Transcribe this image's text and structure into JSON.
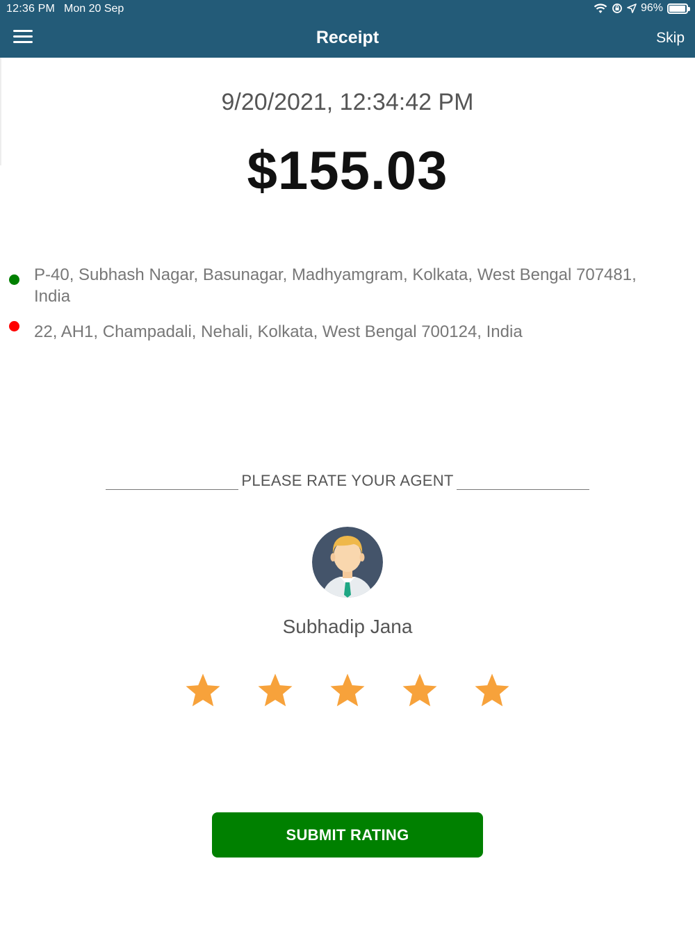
{
  "status_bar": {
    "time": "12:36 PM",
    "date": "Mon 20 Sep",
    "battery": "96%",
    "battery_level": 0.96
  },
  "header": {
    "title": "Receipt",
    "skip_label": "Skip",
    "menu_icon": "hamburger-menu-icon"
  },
  "receipt": {
    "datetime": "9/20/2021, 12:34:42 PM",
    "amount": "$155.03",
    "pickup": {
      "address": "P-40, Subhash Nagar, Basunagar, Madhyamgram, Kolkata, West Bengal 707481, India",
      "dot_color": "#008000"
    },
    "dropoff": {
      "address": "22, AH1, Champadali, Nehali, Kolkata, West Bengal 700124, India",
      "dot_color": "#ff0000"
    }
  },
  "rating": {
    "heading": "PLEASE RATE YOUR AGENT",
    "agent_name": "Subhadip Jana",
    "stars_max": 5,
    "stars_selected": 5,
    "star_color": "#f7a23b",
    "submit_label": "SUBMIT RATING",
    "submit_color": "#008000"
  },
  "colors": {
    "header_bg": "#235b78"
  }
}
